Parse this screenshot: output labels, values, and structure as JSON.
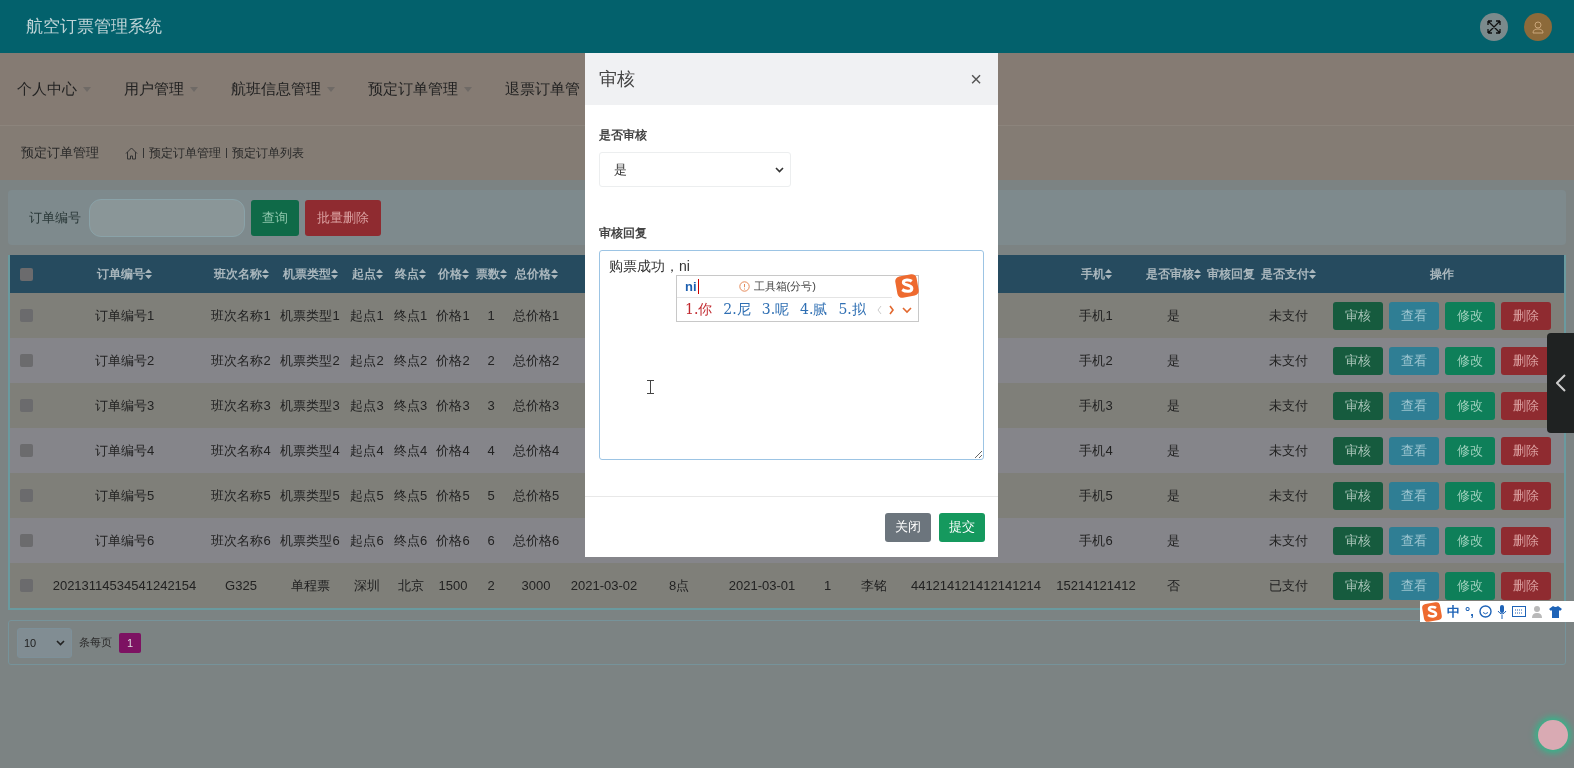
{
  "app": {
    "title": "航空订票管理系统"
  },
  "nav": [
    {
      "label": "个人中心",
      "caret": true
    },
    {
      "label": "用户管理",
      "caret": true
    },
    {
      "label": "航班信息管理",
      "caret": true
    },
    {
      "label": "预定订单管理",
      "caret": true
    },
    {
      "label": "退票订单管",
      "caret": false
    }
  ],
  "breadcrumb": {
    "title": "预定订单管理",
    "path": [
      "预定订单管理",
      "预定订单列表"
    ]
  },
  "search": {
    "label": "订单编号",
    "buttons": [
      {
        "kind": "search",
        "label": "查询"
      },
      {
        "kind": "delete",
        "label": "批量删除"
      }
    ]
  },
  "table": {
    "select_all": {
      "checked": false
    },
    "columns": [
      {
        "label": "订单编号",
        "sortable": true
      },
      {
        "label": "班次名称",
        "sortable": true
      },
      {
        "label": "机票类型",
        "sortable": true
      },
      {
        "label": "起点",
        "sortable": true
      },
      {
        "label": "终点",
        "sortable": true
      },
      {
        "label": "价格",
        "sortable": true
      },
      {
        "label": "票数",
        "sortable": true
      },
      {
        "label": "总价格",
        "sortable": true
      },
      {},
      {},
      {},
      {},
      {},
      {},
      {
        "label": "手机",
        "sortable": true
      },
      {
        "label": "是否审核",
        "sortable": true
      },
      {
        "label": "审核回复",
        "sortable": false
      },
      {
        "label": "是否支付",
        "sortable": true
      }
    ],
    "actions_label": "操作",
    "rows": [
      {
        "checked": false,
        "cells": [
          "订单编号1",
          "班次名称1",
          "机票类型1",
          "起点1",
          "终点1",
          "价格1",
          "1",
          "总价格1",
          null,
          null,
          null,
          null,
          null,
          null,
          "手机1",
          "是",
          null,
          "未支付"
        ],
        "actions": [
          {
            "kind": "review",
            "label": "审核"
          },
          {
            "kind": "view",
            "label": "查看"
          },
          {
            "kind": "edit",
            "label": "修改"
          },
          {
            "kind": "delete",
            "label": "删除"
          }
        ]
      },
      {
        "checked": false,
        "cells": [
          "订单编号2",
          "班次名称2",
          "机票类型2",
          "起点2",
          "终点2",
          "价格2",
          "2",
          "总价格2",
          null,
          null,
          null,
          null,
          null,
          null,
          "手机2",
          "是",
          null,
          "未支付"
        ],
        "actions": [
          {
            "kind": "review",
            "label": "审核"
          },
          {
            "kind": "view",
            "label": "查看"
          },
          {
            "kind": "edit",
            "label": "修改"
          },
          {
            "kind": "delete",
            "label": "删除"
          }
        ]
      },
      {
        "checked": false,
        "cells": [
          "订单编号3",
          "班次名称3",
          "机票类型3",
          "起点3",
          "终点3",
          "价格3",
          "3",
          "总价格3",
          null,
          null,
          null,
          null,
          null,
          null,
          "手机3",
          "是",
          null,
          "未支付"
        ],
        "actions": [
          {
            "kind": "review",
            "label": "审核"
          },
          {
            "kind": "view",
            "label": "查看"
          },
          {
            "kind": "edit",
            "label": "修改"
          },
          {
            "kind": "delete",
            "label": "删除"
          }
        ]
      },
      {
        "checked": false,
        "cells": [
          "订单编号4",
          "班次名称4",
          "机票类型4",
          "起点4",
          "终点4",
          "价格4",
          "4",
          "总价格4",
          null,
          null,
          null,
          null,
          null,
          null,
          "手机4",
          "是",
          null,
          "未支付"
        ],
        "actions": [
          {
            "kind": "review",
            "label": "审核"
          },
          {
            "kind": "view",
            "label": "查看"
          },
          {
            "kind": "edit",
            "label": "修改"
          },
          {
            "kind": "delete",
            "label": "删除"
          }
        ]
      },
      {
        "checked": false,
        "cells": [
          "订单编号5",
          "班次名称5",
          "机票类型5",
          "起点5",
          "终点5",
          "价格5",
          "5",
          "总价格5",
          null,
          null,
          null,
          null,
          null,
          null,
          "手机5",
          "是",
          null,
          "未支付"
        ],
        "actions": [
          {
            "kind": "review",
            "label": "审核"
          },
          {
            "kind": "view",
            "label": "查看"
          },
          {
            "kind": "edit",
            "label": "修改"
          },
          {
            "kind": "delete",
            "label": "删除"
          }
        ]
      },
      {
        "checked": false,
        "cells": [
          "订单编号6",
          "班次名称6",
          "机票类型6",
          "起点6",
          "终点6",
          "价格6",
          "6",
          "总价格6",
          null,
          null,
          null,
          null,
          null,
          null,
          "手机6",
          "是",
          null,
          "未支付"
        ],
        "actions": [
          {
            "kind": "review",
            "label": "审核"
          },
          {
            "kind": "view",
            "label": "查看"
          },
          {
            "kind": "edit",
            "label": "修改"
          },
          {
            "kind": "delete",
            "label": "删除"
          }
        ]
      },
      {
        "checked": false,
        "cells": [
          "20213114534541242154",
          "G325",
          "单程票",
          "深圳",
          "北京",
          "1500",
          "2",
          "3000",
          "2021-03-02",
          "8点",
          "2021-03-01",
          "1",
          "李铭",
          "441214121412141214",
          "15214121412",
          "否",
          null,
          "已支付"
        ],
        "actions": [
          {
            "kind": "review",
            "label": "审核"
          },
          {
            "kind": "view",
            "label": "查看"
          },
          {
            "kind": "edit",
            "label": "修改"
          },
          {
            "kind": "delete",
            "label": "删除"
          }
        ]
      }
    ]
  },
  "pagination": {
    "page_size": "10",
    "per_page_label": "条每页",
    "pages": [
      {
        "label": "1",
        "selected": true
      }
    ]
  },
  "modal": {
    "title": "审核",
    "close": "×",
    "select": {
      "label": "是否审核",
      "value": "是"
    },
    "textarea": {
      "label": "审核回复",
      "value": "购票成功，ni"
    },
    "buttons": [
      {
        "kind": "close",
        "label": "关闭"
      },
      {
        "kind": "submit",
        "label": "提交"
      }
    ]
  },
  "ime": {
    "composition": "ni",
    "hint": "工具箱(分号)",
    "candidates": [
      {
        "label": "1.你",
        "selected": true
      },
      {
        "label": "2.尼",
        "selected": false
      },
      {
        "label": "3.呢",
        "selected": false
      },
      {
        "label": "4.腻",
        "selected": false
      },
      {
        "label": "5.拟",
        "selected": false
      }
    ]
  },
  "ime_toolbar": {
    "mode": "中",
    "punctuation": "°,"
  }
}
